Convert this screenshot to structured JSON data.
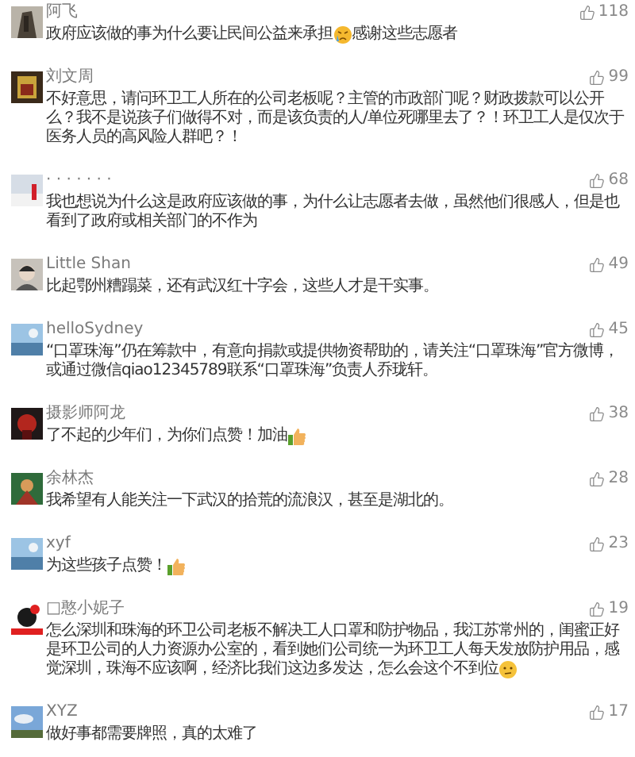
{
  "comments": [
    {
      "name": "阿飞",
      "likes": "118",
      "lines": [
        [
          {
            "kind": "text",
            "text": "政府应该做的事为什么要让民间公益来承担"
          },
          {
            "kind": "cry"
          },
          {
            "kind": "text",
            "text": "感谢这些志愿者"
          }
        ]
      ]
    },
    {
      "name": "刘文周",
      "likes": "99",
      "lines": [
        [
          {
            "kind": "text",
            "text": "不好意思，请问环卫工人所在的公司老板呢？主管的市政部门呢？财政拨款可以公开"
          }
        ],
        [
          {
            "kind": "text",
            "text": "么？我不是说孩子们做得不对，而是该负责的人/单位死哪里去了？！环卫工人是仅次于"
          }
        ],
        [
          {
            "kind": "text",
            "text": "医务人员的高风险人群吧？！"
          }
        ]
      ]
    },
    {
      "name": "· · · · · · ·",
      "likes": "68",
      "lines": [
        [
          {
            "kind": "text",
            "text": "我也想说为什么这是政府应该做的事，为什么让志愿者去做，虽然他们很感人，但是也"
          }
        ],
        [
          {
            "kind": "text",
            "text": "看到了政府或相关部门的不作为"
          }
        ]
      ]
    },
    {
      "name": "Little Shan",
      "likes": "49",
      "lines": [
        [
          {
            "kind": "text",
            "text": "比起鄂州糟蹋菜，还有武汉红十字会，这些人才是干实事。"
          }
        ]
      ]
    },
    {
      "name": "helloSydney",
      "likes": "45",
      "lines": [
        [
          {
            "kind": "text",
            "text": "“口罩珠海”仍在筹款中，有意向捐款或提供物资帮助的，请关注“口罩珠海”官方微博，"
          }
        ],
        [
          {
            "kind": "text",
            "text": "或通过微信qiao12345789联系“口罩珠海”负责人乔珑轩。"
          }
        ]
      ]
    },
    {
      "name": "摄影师阿龙",
      "likes": "38",
      "lines": [
        [
          {
            "kind": "text",
            "text": "了不起的少年们，为你们点赞！加油"
          },
          {
            "kind": "thumb"
          }
        ]
      ]
    },
    {
      "name": "余林杰",
      "likes": "28",
      "lines": [
        [
          {
            "kind": "text",
            "text": "我希望有人能关注一下武汉的拾荒的流浪汉，甚至是湖北的。"
          }
        ]
      ]
    },
    {
      "name": "xyf",
      "likes": "23",
      "lines": [
        [
          {
            "kind": "text",
            "text": "为这些孩子点赞！"
          },
          {
            "kind": "thumb"
          }
        ]
      ]
    },
    {
      "name": "□憨小妮子",
      "likes": "19",
      "lines": [
        [
          {
            "kind": "text",
            "text": "怎么深圳和珠海的环卫公司老板不解决工人口罩和防护物品，我江苏常州的，闺蜜正好"
          }
        ],
        [
          {
            "kind": "text",
            "text": "是环卫公司的人力资源办公室的，看到她们公司统一为环卫工人每天发放防护用品，感"
          }
        ],
        [
          {
            "kind": "text",
            "text": "觉深圳，珠海不应该啊，经济比我们这边多发达，怎么会这个不到位"
          },
          {
            "kind": "think"
          }
        ]
      ]
    },
    {
      "name": "XYZ",
      "likes": "17",
      "lines": [
        [
          {
            "kind": "text",
            "text": "做好事都需要牌照，真的太难了"
          }
        ]
      ]
    }
  ]
}
